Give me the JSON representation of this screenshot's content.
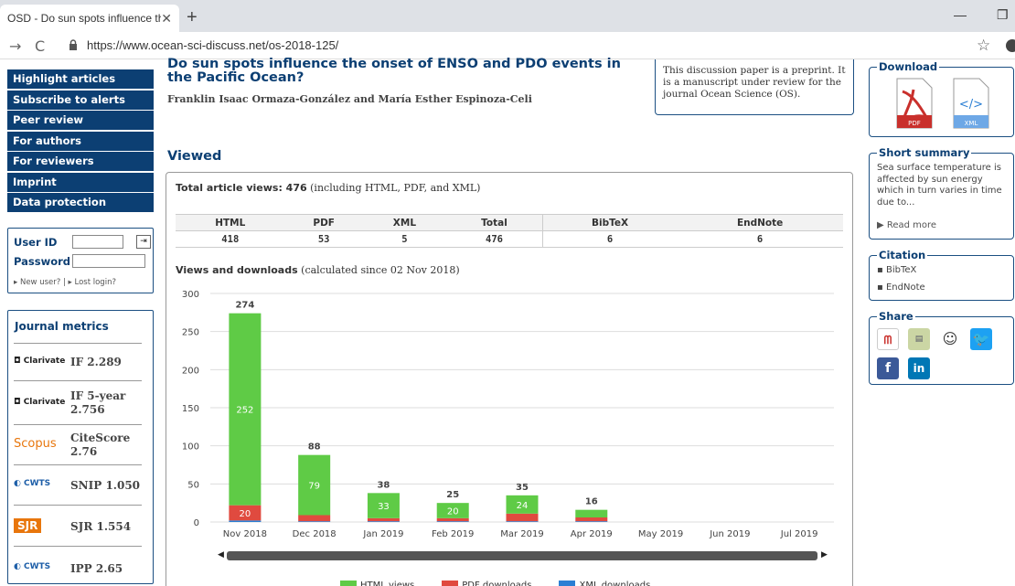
{
  "browser": {
    "tab_title": "OSD - Do sun spots influence the",
    "url": "https://www.ocean-sci-discuss.net/os-2018-125/"
  },
  "sidebar": {
    "menu": [
      "Highlight articles",
      "Subscribe to alerts",
      "Peer review",
      "For authors",
      "For reviewers",
      "Imprint",
      "Data protection"
    ],
    "login": {
      "user_label": "User ID",
      "password_label": "Password",
      "links": "▸ New user? | ▸ Lost login?"
    },
    "metrics_title": "Journal metrics",
    "metrics": [
      {
        "logo": "Clarivate",
        "label": "IF 2.289"
      },
      {
        "logo": "Clarivate",
        "label": "IF 5-year 2.756"
      },
      {
        "logo": "Scopus",
        "label": "CiteScore 2.76"
      },
      {
        "logo": "CWTS",
        "label": "SNIP 1.050"
      },
      {
        "logo": "SJR",
        "label": "SJR 1.554"
      },
      {
        "logo": "CWTS",
        "label": "IPP 2.65"
      }
    ]
  },
  "paper": {
    "title": "Do sun spots influence the onset of ENSO and PDO events in the Pacific Ocean?",
    "authors": "Franklin Isaac Ormaza-González and María Esther Espinoza-Celi",
    "preprint_note": "This discussion paper is a preprint. It is a manuscript under review for the journal Ocean Science (OS)."
  },
  "viewed": {
    "heading": "Viewed",
    "total_label": "Total article views: 476",
    "total_suffix": "(including HTML, PDF, and XML)",
    "table": {
      "headers": [
        "HTML",
        "PDF",
        "XML",
        "Total",
        "BibTeX",
        "EndNote"
      ],
      "values": [
        "418",
        "53",
        "5",
        "476",
        "6",
        "6"
      ]
    },
    "caption_bold": "Views and downloads",
    "caption_rest": "(calculated since 02 Nov 2018)"
  },
  "chart_data": {
    "type": "bar",
    "stacked": true,
    "categories": [
      "Nov 2018",
      "Dec 2018",
      "Jan 2019",
      "Feb 2019",
      "Mar 2019",
      "Apr 2019",
      "May 2019",
      "Jun 2019",
      "Jul 2019"
    ],
    "series": [
      {
        "name": "HTML views",
        "color": "#5fcb46",
        "values": [
          252,
          79,
          33,
          20,
          24,
          10,
          0,
          0,
          0
        ]
      },
      {
        "name": "PDF downloads",
        "color": "#e04a3f",
        "values": [
          20,
          8,
          4,
          4,
          10,
          5,
          0,
          0,
          0
        ]
      },
      {
        "name": "XML downloads",
        "color": "#2b7fd4",
        "values": [
          2,
          1,
          1,
          1,
          1,
          1,
          0,
          0,
          0
        ]
      }
    ],
    "totals": [
      274,
      88,
      38,
      25,
      35,
      16,
      null,
      null,
      null
    ],
    "inner_labels_html": [
      "252",
      "79",
      "33",
      "20",
      "24",
      null,
      null,
      null,
      null
    ],
    "inner_labels_pdf": [
      "20",
      null,
      null,
      null,
      null,
      null,
      null,
      null,
      null
    ],
    "yticks": [
      "0",
      "50",
      "100",
      "150",
      "200",
      "250",
      "300"
    ],
    "ylim": [
      0,
      300
    ],
    "grid": true,
    "legend_position": "bottom"
  },
  "right": {
    "download_title": "Download",
    "pdf_label": "PDF",
    "xml_label": "XML",
    "summary_title": "Short summary",
    "summary_text": "Sea surface temperature is affected by sun energy which in turn varies in time due to...",
    "read_more": "▶ Read more",
    "citation_title": "Citation",
    "citation_items": [
      "BibTeX",
      "EndNote"
    ],
    "share_title": "Share"
  },
  "colors": {
    "brand_blue": "#0c3f73"
  }
}
